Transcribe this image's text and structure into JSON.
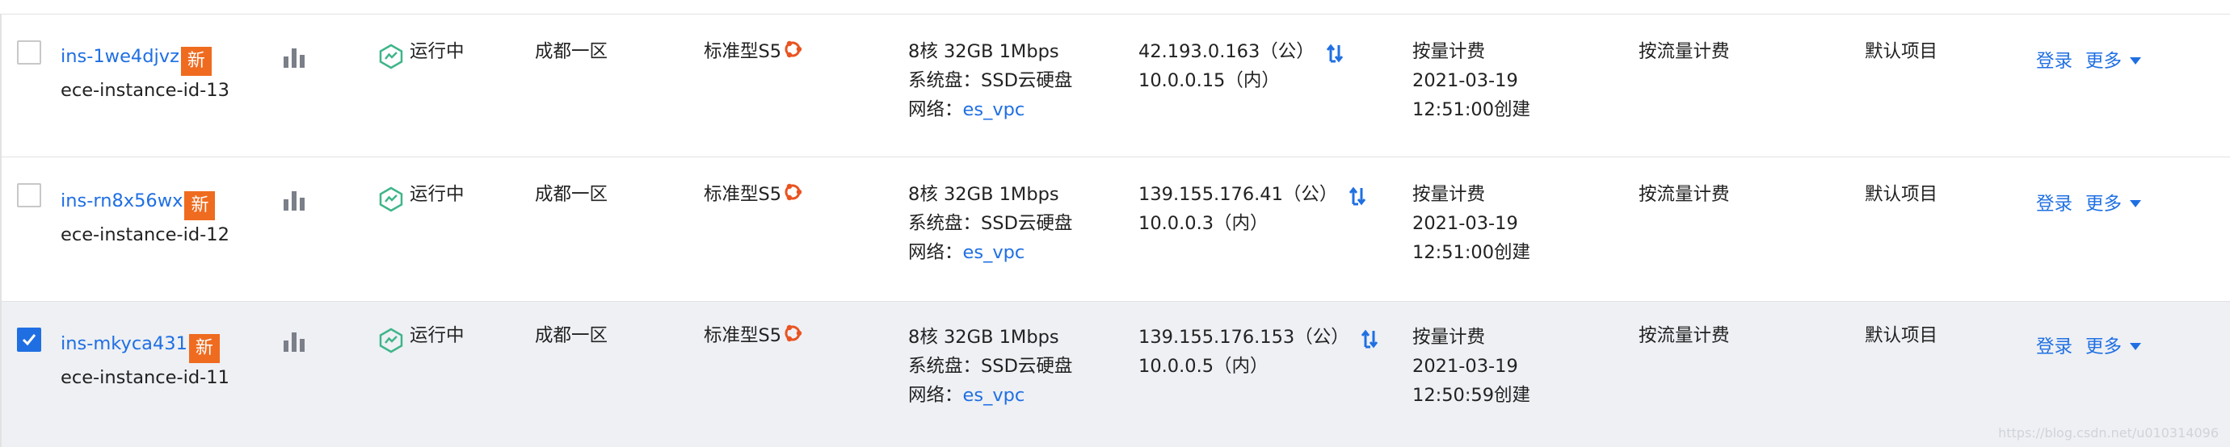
{
  "rows": [
    {
      "selected": false,
      "instance_id": "ins-1we4djvz",
      "badge": "新",
      "instance_name": "ece-instance-id-13",
      "status": "运行中",
      "zone": "成都一区",
      "model": "标准型S5",
      "spec": "8核 32GB 1Mbps",
      "disk": "系统盘：SSD云硬盘",
      "network_label": "网络：",
      "network_vpc": "es_vpc",
      "public_ip": "42.193.0.163（公）",
      "private_ip": "10.0.0.15（内）",
      "billing": "按量计费",
      "date": "2021-03-19",
      "time_created": "12:51:00创建",
      "network_billing": "按流量计费",
      "project": "默认项目",
      "login": "登录",
      "more": "更多"
    },
    {
      "selected": false,
      "instance_id": "ins-rn8x56wx",
      "badge": "新",
      "instance_name": "ece-instance-id-12",
      "status": "运行中",
      "zone": "成都一区",
      "model": "标准型S5",
      "spec": "8核 32GB 1Mbps",
      "disk": "系统盘：SSD云硬盘",
      "network_label": "网络：",
      "network_vpc": "es_vpc",
      "public_ip": "139.155.176.41（公）",
      "private_ip": "10.0.0.3（内）",
      "billing": "按量计费",
      "date": "2021-03-19",
      "time_created": "12:51:00创建",
      "network_billing": "按流量计费",
      "project": "默认项目",
      "login": "登录",
      "more": "更多"
    },
    {
      "selected": true,
      "instance_id": "ins-mkyca431",
      "badge": "新",
      "instance_name": "ece-instance-id-11",
      "status": "运行中",
      "zone": "成都一区",
      "model": "标准型S5",
      "spec": "8核 32GB 1Mbps",
      "disk": "系统盘：SSD云硬盘",
      "network_label": "网络：",
      "network_vpc": "es_vpc",
      "public_ip": "139.155.176.153（公）",
      "private_ip": "10.0.0.5（内）",
      "billing": "按量计费",
      "date": "2021-03-19",
      "time_created": "12:50:59创建",
      "network_billing": "按流量计费",
      "project": "默认项目",
      "login": "登录",
      "more": "更多"
    }
  ],
  "colors": {
    "link": "#1f6fe3",
    "badge": "#ef6b1f",
    "status_icon": "#3fb58a",
    "os_icon": "#e95420",
    "selected_row_bg": "#eef0f4"
  },
  "icons": [
    "bar-chart-icon",
    "running-status-icon",
    "ubuntu-os-icon",
    "swap-ip-icon",
    "checkmark-icon",
    "caret-down-icon"
  ],
  "watermark": "https://blog.csdn.net/u010314096"
}
